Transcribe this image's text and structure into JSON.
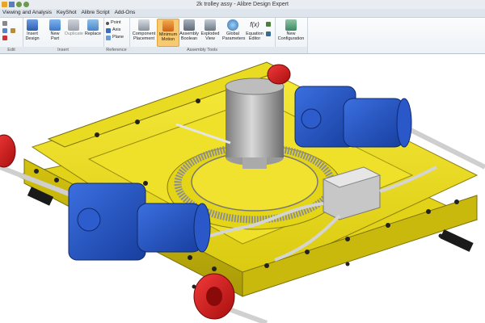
{
  "window": {
    "title": "2k trolley assy - Alibre Design Expert"
  },
  "menu": {
    "items": [
      "Viewing and Analysis",
      "KeyShot",
      "Alibre Script",
      "Add-Ons"
    ]
  },
  "ribbon": {
    "groups": {
      "edit": "Edit",
      "insert": "Insert",
      "reference": "Reference",
      "assembly_tools": "Assembly Tools"
    },
    "buttons": {
      "insert_design": "Insert Design",
      "new_part": "New Part",
      "duplicate": "Duplicate",
      "replace": "Replace",
      "point": "Point",
      "axis": "Axis",
      "plane": "Plane",
      "component_placement": "Component Placement",
      "minimum_motion": "Minimum Motion",
      "assembly_boolean": "Assembly Boolean",
      "exploded_view": "Exploded View",
      "global_parameters": "Global Parameters",
      "equation_editor": "Equation Editor",
      "new_configuration": "New Configuration"
    },
    "equation_symbol": "f(x)"
  },
  "colors": {
    "ribbon_active": "#f7c970",
    "frame_yellow": "#f2e21a",
    "motor_blue": "#1f4fc4",
    "wheel_red": "#d81818",
    "gear_gray": "#8f8f8f"
  }
}
